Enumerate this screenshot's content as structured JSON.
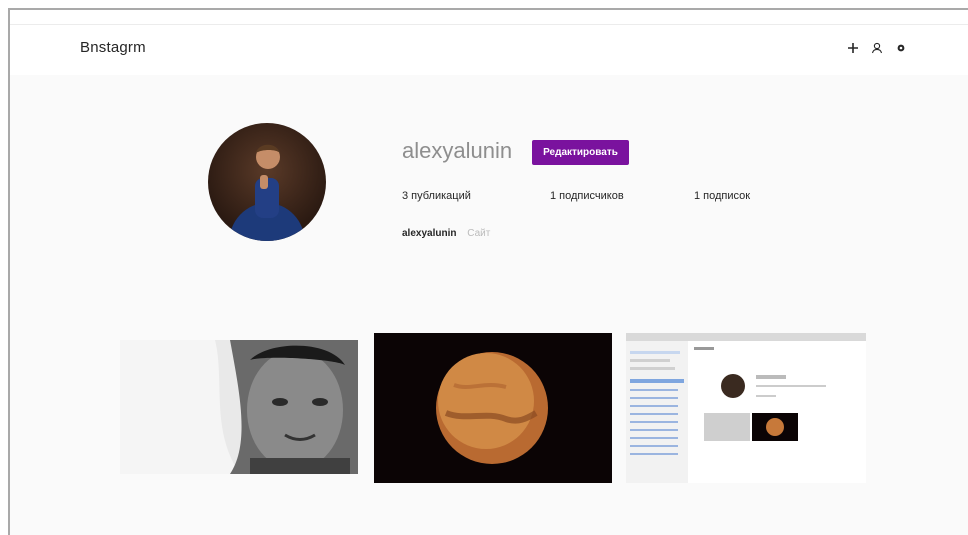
{
  "app": {
    "logo": "Bnstagrm"
  },
  "header": {
    "icons": [
      "plus-icon",
      "user-icon",
      "gear-icon"
    ]
  },
  "profile": {
    "username": "alexyalunin",
    "edit_button": "Редактировать",
    "stats": {
      "posts": "3 публикаций",
      "followers": "1 подписчиков",
      "following": "1 подписок"
    },
    "bio_name": "alexyalunin",
    "bio_link": "Сайт"
  },
  "posts": [
    "post-1",
    "post-2",
    "post-3"
  ],
  "colors": {
    "accent": "#7a129e",
    "text": "#262626",
    "muted": "#8e8e8e",
    "background": "#fafafa"
  }
}
